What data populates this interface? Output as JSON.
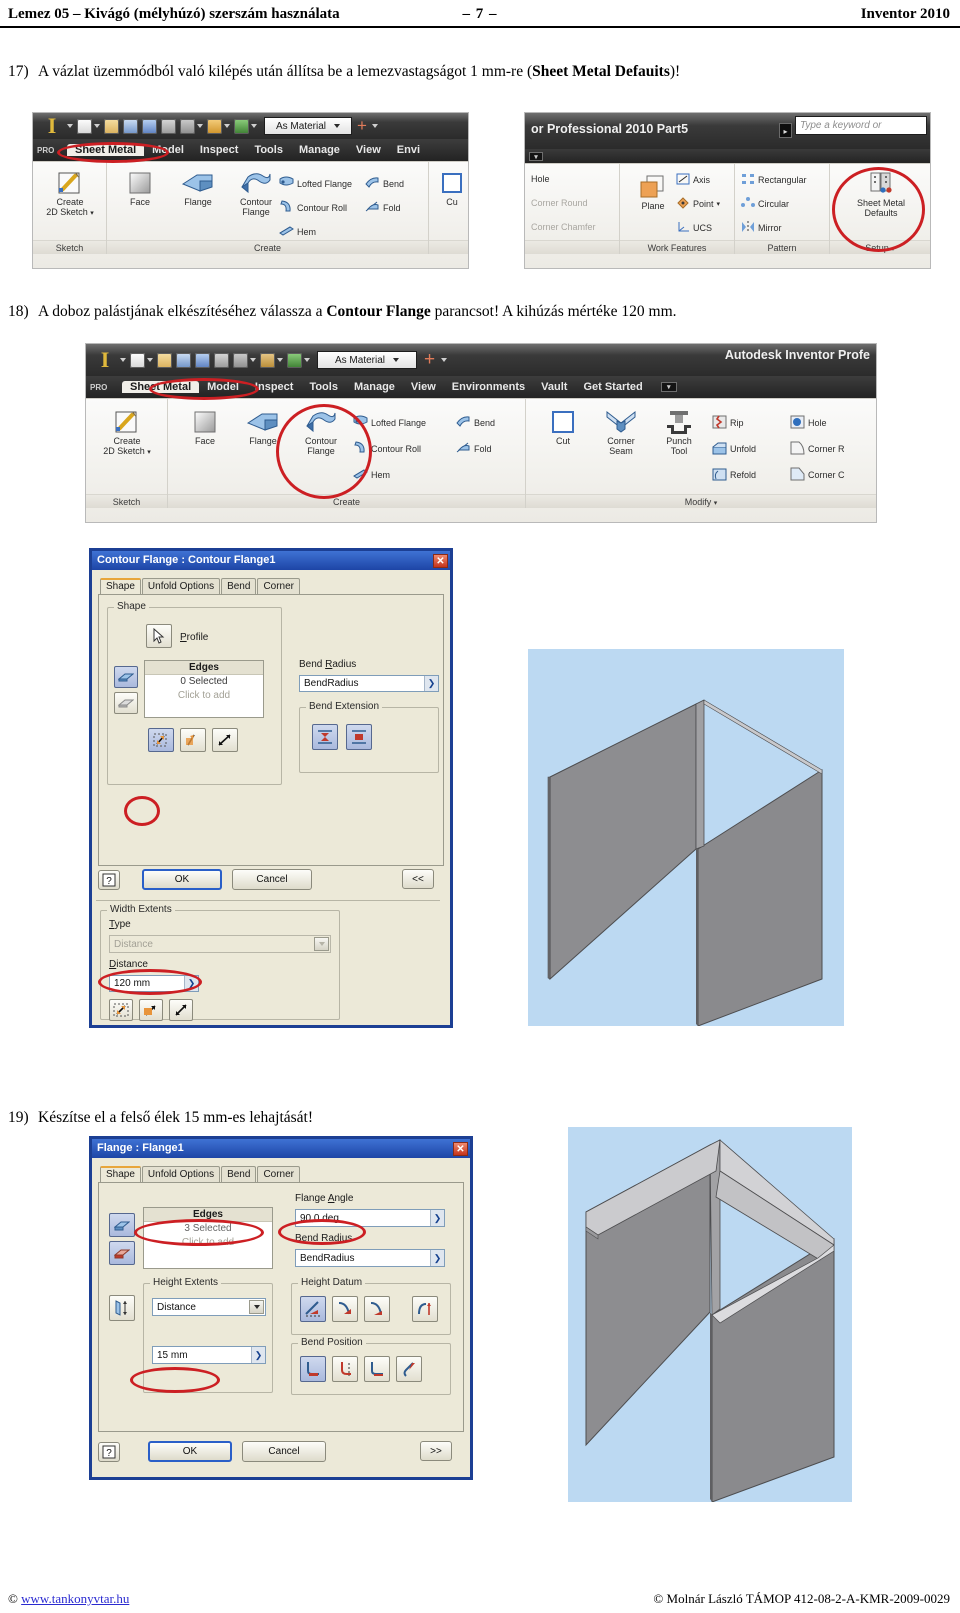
{
  "header": {
    "left": "Lemez 05 – Kivágó (mélyhúzó) szerszám használata",
    "page": "– 7 –",
    "right": "Inventor 2010"
  },
  "steps": [
    {
      "num": "17)",
      "text_before": "A vázlat üzemmódból való kilépés után állítsa be a lemezvastagságot 1 mm-re (",
      "bold": "Sheet Metal Defauits",
      "text_after": ")!"
    },
    {
      "num": "18)",
      "text_before": "A doboz palástjának elkészítéséhez válassza a ",
      "bold": "Contour Flange",
      "text_after": " parancsot! A kihúzás mértéke 120 mm."
    },
    {
      "num": "19)",
      "text_before": "Készítse el a felső élek 15 mm-es lehajtását!",
      "bold": "",
      "text_after": ""
    }
  ],
  "ribbon_left_17": {
    "quick_access": {
      "material_combo": "As Material",
      "logo": "I",
      "brand_fragment": "PRO"
    },
    "tabs": [
      "Sheet Metal",
      "Model",
      "Inspect",
      "Tools",
      "Manage",
      "View",
      "Envi"
    ],
    "active_tab": "Sheet Metal",
    "panels": [
      {
        "label": "Sketch",
        "buttons": [
          "Create\n2D Sketch"
        ]
      },
      {
        "label": "Create",
        "buttons": [
          "Face",
          "Flange",
          "Contour\nFlange"
        ],
        "small": [
          "Lofted Flange",
          "Contour Roll",
          "Hem",
          "Bend",
          "Fold"
        ]
      },
      {
        "label": "",
        "buttons": [
          "Cu"
        ]
      }
    ],
    "highlight": "Sheet Metal"
  },
  "ribbon_right_17": {
    "title_fragment": "or Professional 2010    Part5",
    "search_placeholder": "Type a keyword or",
    "items_left": [
      "Hole",
      "Corner Round",
      "Corner Chamfer"
    ],
    "work_features": {
      "label": "Work Features",
      "big": "Plane",
      "small": [
        "Axis",
        "Point",
        "UCS"
      ]
    },
    "pattern": {
      "label": "Pattern",
      "small": [
        "Rectangular",
        "Circular",
        "Mirror"
      ]
    },
    "setup": {
      "label": "Setup",
      "big": "Sheet Metal\nDefaults"
    },
    "highlight": "Sheet Metal Defaults"
  },
  "ribbon_18": {
    "quick_access": {
      "material_combo": "As Material",
      "logo": "I",
      "brand_fragment": "PRO"
    },
    "app_title": "Autodesk Inventor Profe",
    "tabs": [
      "Sheet Metal",
      "Model",
      "Inspect",
      "Tools",
      "Manage",
      "View",
      "Environments",
      "Vault",
      "Get Started"
    ],
    "active_tab": "Sheet Metal",
    "sketch_panel": {
      "label": "Sketch",
      "button": "Create\n2D Sketch"
    },
    "create_panel": {
      "label": "Create",
      "big": [
        "Face",
        "Flange",
        "Contour\nFlange"
      ],
      "small": [
        "Lofted Flange",
        "Contour Roll",
        "Hem",
        "Bend",
        "Fold"
      ]
    },
    "modify_panel": {
      "label": "Modify",
      "big": [
        "Cut",
        "Corner\nSeam",
        "Punch\nTool"
      ],
      "small": [
        "Rip",
        "Unfold",
        "Refold",
        "Hole",
        "Corner R",
        "Corner C"
      ]
    },
    "highlights": [
      "Sheet Metal",
      "Contour Flange"
    ]
  },
  "contour_flange_dialog": {
    "title": "Contour Flange : Contour Flange1",
    "close": "✕",
    "tabs": [
      "Shape",
      "Unfold Options",
      "Bend",
      "Corner"
    ],
    "active_tab": "Shape",
    "shape_group": {
      "label": "Shape",
      "profile_button": "Profile",
      "edges_header": "Edges",
      "edges_count": "0 Selected",
      "edges_hint": "Click to add"
    },
    "bend_radius": {
      "label": "Bend Radius",
      "value": "BendRadius",
      "arrow": "❯"
    },
    "bend_extension": {
      "label": "Bend Extension"
    },
    "buttons": {
      "help": "?",
      "ok": "OK",
      "cancel": "Cancel",
      "collapse": "<<"
    },
    "width_extents": {
      "label": "Width Extents",
      "type_label": "Type",
      "type_value": "Distance",
      "distance_label": "Distance",
      "distance_value": "120 mm",
      "arrow": "❯"
    },
    "highlights": [
      "extend-direction-button",
      "120 mm"
    ]
  },
  "flange_dialog": {
    "title": "Flange : Flange1",
    "close": "✕",
    "tabs": [
      "Shape",
      "Unfold Options",
      "Bend",
      "Corner"
    ],
    "active_tab": "Shape",
    "edges": {
      "header": "Edges",
      "count": "3 Selected",
      "hint": "Click to add"
    },
    "flange_angle": {
      "label": "Flange Angle",
      "value": "90,0 deg",
      "arrow": "❯"
    },
    "bend_radius": {
      "label": "Bend Radius",
      "value": "BendRadius",
      "arrow": "❯"
    },
    "height_extents": {
      "label": "Height Extents",
      "type_value": "Distance",
      "distance_value": "15 mm",
      "arrow": "❯"
    },
    "height_datum": {
      "label": "Height Datum"
    },
    "bend_position": {
      "label": "Bend Position"
    },
    "buttons": {
      "help": "?",
      "ok": "OK",
      "cancel": "Cancel",
      "expand": ">>"
    },
    "highlights": [
      "3 Selected",
      "90,0 deg",
      "15 mm"
    ]
  },
  "footer": {
    "left_mark": "©",
    "left_link": "www.tankonyvtar.hu",
    "right": "© Molnár László TÁMOP 412-08-2-A-KMR-2009-0029"
  },
  "colors": {
    "annotation_red": "#cc1f23",
    "dialog_blue": "#1c3f94",
    "titlebar_blue": "#2a55b4",
    "viewport_blue": "#bcd9f2",
    "metal_gray": "#8d8d90",
    "link_blue": "#2a2ad0"
  }
}
